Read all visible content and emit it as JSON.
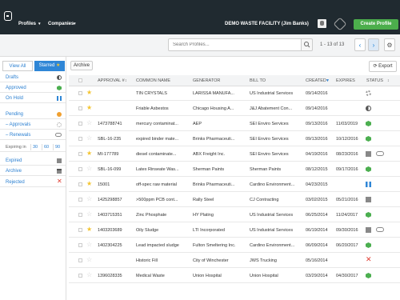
{
  "topbar": {
    "nav": [
      "Profiles",
      "Companies"
    ],
    "facility": "DEMO WASTE FACILITY (Jim Banks)",
    "create_label": "Create Profile"
  },
  "search": {
    "placeholder": "Search Profiles...",
    "pager": "1 - 13 of 13"
  },
  "sidebar": {
    "tabs": [
      "View All",
      "Starred"
    ],
    "items": [
      {
        "label": "Drafts",
        "icon": "half-circle-icon",
        "color": "#555555"
      },
      {
        "label": "Approved",
        "icon": "hexagon-icon",
        "color": "#4caf50"
      },
      {
        "label": "On Hold",
        "icon": "pause-icon",
        "color": "#2f86d6"
      },
      {
        "label": "Pending",
        "icon": "circle-icon",
        "color": "#f0a030"
      },
      {
        "label": "– Approvals",
        "icon": "gear-icon",
        "color": "#999999"
      },
      {
        "label": "– Renewals",
        "icon": "link-icon",
        "color": "#888888"
      }
    ],
    "expiring": {
      "label": "Expiring in",
      "days": [
        "30",
        "60",
        "90"
      ]
    },
    "items2": [
      {
        "label": "Expired",
        "icon": "square-icon",
        "color": "#888888"
      },
      {
        "label": "Archive",
        "icon": "archive-icon",
        "color": "#888888"
      },
      {
        "label": "Rejected",
        "icon": "x-icon",
        "color": "#e03a2f"
      }
    ]
  },
  "toolbar": {
    "archive_label": "Archive",
    "export_label": "Export"
  },
  "table": {
    "headers": [
      "APPROVAL #",
      "COMMON NAME",
      "GENERATOR",
      "BILL TO",
      "CREATED",
      "EXPIRES",
      "STATUS"
    ],
    "rows": [
      {
        "starred": true,
        "approval": "",
        "name": "TIN CRYSTALS",
        "generator": "LARISSA MANUFA...",
        "bill_to": "US Industrial Services",
        "created": "09/14/2016",
        "expires": "",
        "status": "gear",
        "extra": ""
      },
      {
        "starred": true,
        "approval": "",
        "name": "Friable Asbestos",
        "generator": "Chicago Housing A...",
        "bill_to": "J&J Abatement Con...",
        "created": "09/14/2016",
        "expires": "",
        "status": "half",
        "extra": ""
      },
      {
        "starred": false,
        "approval": "1473788741",
        "name": "mercury contaminat...",
        "generator": "AEP",
        "bill_to": "SEI Enviro Services",
        "created": "09/13/2016",
        "expires": "11/03/2019",
        "status": "green",
        "extra": ""
      },
      {
        "starred": false,
        "approval": "SBL-16-235",
        "name": "expired binder mate...",
        "generator": "Brinks Pharmaceuti...",
        "bill_to": "SEI Enviro Services",
        "created": "09/13/2016",
        "expires": "10/12/2016",
        "status": "green",
        "extra": ""
      },
      {
        "starred": true,
        "approval": "MI-177789",
        "name": "diesel contaminate...",
        "generator": "ABX Freight Inc.",
        "bill_to": "SEI Enviro Services",
        "created": "04/19/2016",
        "expires": "08/23/2016",
        "status": "grey",
        "extra": "link"
      },
      {
        "starred": false,
        "approval": "SBL-16-099",
        "name": "Latex Rinseate Was...",
        "generator": "Sherman Paints",
        "bill_to": "Sherman Paints",
        "created": "08/12/2015",
        "expires": "09/17/2016",
        "status": "green",
        "extra": ""
      },
      {
        "starred": true,
        "approval": "15001",
        "name": "off-spec raw material",
        "generator": "Brinks Pharmaceuti...",
        "bill_to": "Cardino Environment...",
        "created": "04/23/2015",
        "expires": "",
        "status": "blue",
        "extra": ""
      },
      {
        "starred": false,
        "approval": "1425298857",
        "name": ">500ppm PCB cont...",
        "generator": "Rally Steel",
        "bill_to": "CJ Contracting",
        "created": "03/02/2015",
        "expires": "05/21/2016",
        "status": "grey",
        "extra": ""
      },
      {
        "starred": false,
        "approval": "1403715351",
        "name": "Zinc Phosphate",
        "generator": "HY Plating",
        "bill_to": "US Industrial Services",
        "created": "06/25/2014",
        "expires": "11/24/2017",
        "status": "green",
        "extra": ""
      },
      {
        "starred": true,
        "approval": "1403203689",
        "name": "Oily Sludge",
        "generator": "LTI Incorporated",
        "bill_to": "US Industrial Services",
        "created": "06/19/2014",
        "expires": "09/30/2016",
        "status": "grey",
        "extra": "link"
      },
      {
        "starred": false,
        "approval": "1402304225",
        "name": "Lead impacted sludge",
        "generator": "Fulton Smeltering Inc.",
        "bill_to": "Cardino Environment...",
        "created": "06/09/2014",
        "expires": "06/20/2017",
        "status": "green",
        "extra": ""
      },
      {
        "starred": false,
        "approval": "",
        "name": "Historic Fill",
        "generator": "City of Winchester",
        "bill_to": "JWS Trucking",
        "created": "05/16/2014",
        "expires": "",
        "status": "red",
        "extra": ""
      },
      {
        "starred": false,
        "approval": "1396028335",
        "name": "Medical Waste",
        "generator": "Union Hospital",
        "bill_to": "Union Hospital",
        "created": "03/29/2014",
        "expires": "04/30/2017",
        "status": "green",
        "extra": ""
      }
    ]
  }
}
